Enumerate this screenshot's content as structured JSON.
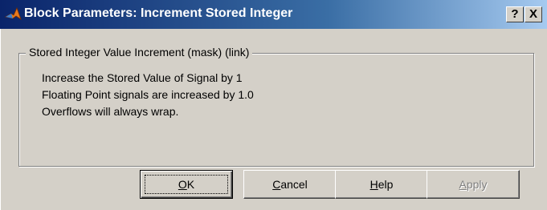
{
  "window": {
    "title": "Block Parameters: Increment Stored Integer",
    "help_glyph": "?",
    "close_glyph": "X",
    "icon": "matlab-logo-icon"
  },
  "group": {
    "legend": "Stored Integer Value Increment (mask) (link)",
    "lines": [
      "Increase the Stored Value of Signal by 1",
      "Floating Point signals are increased by 1.0",
      "Overflows will always wrap."
    ]
  },
  "buttons": {
    "ok": {
      "mnemonic": "O",
      "rest": "K"
    },
    "cancel": {
      "mnemonic": "C",
      "rest": "ancel"
    },
    "help": {
      "mnemonic": "H",
      "rest": "elp"
    },
    "apply": {
      "mnemonic": "A",
      "rest": "pply",
      "enabled": false
    }
  }
}
